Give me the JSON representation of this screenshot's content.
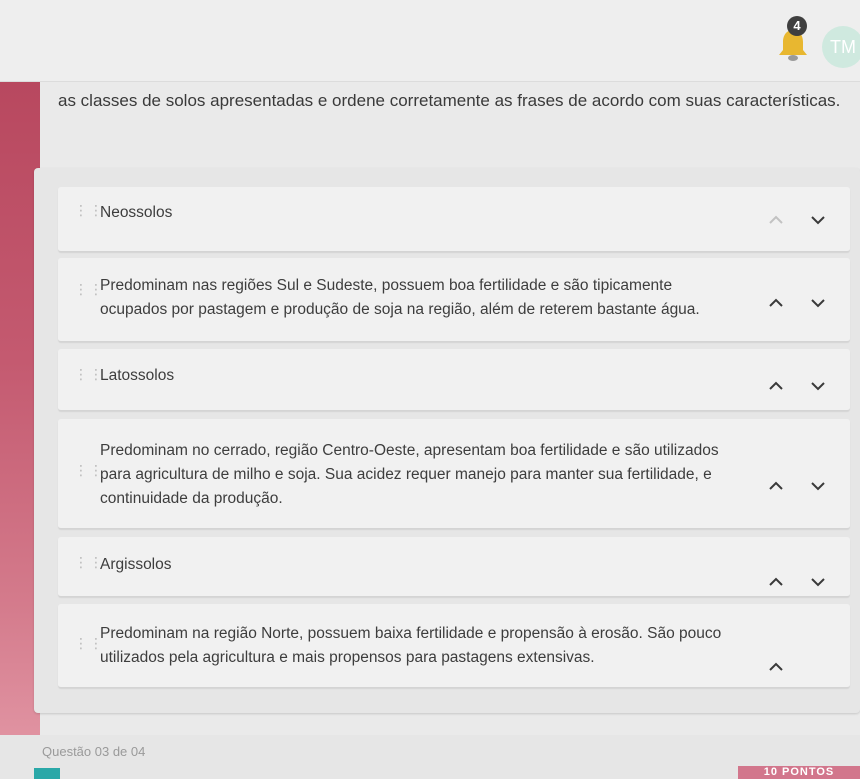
{
  "header": {
    "notification_count": "4",
    "avatar_initials": "TM",
    "colors": {
      "badge": "#3f3f3f",
      "avatar": "#cfe9df"
    }
  },
  "question": {
    "intro": "as classes de solos apresentadas e ordene corretamente as frases de acordo com suas características."
  },
  "items": [
    {
      "text": "Neossolos",
      "up": false,
      "down": true
    },
    {
      "text": "Predominam nas regiões Sul e Sudeste, possuem boa fertilidade e são tipicamente ocupados por pastagem e produção de soja na região, além de reterem bastante água.",
      "up": true,
      "down": true
    },
    {
      "text": "Latossolos",
      "up": true,
      "down": true
    },
    {
      "text": "Predominam no cerrado, região Centro-Oeste, apresentam boa fertilidade e são utilizados para agricultura de milho e soja. Sua acidez requer manejo para manter sua fertilidade, e continuidade da produção.",
      "up": true,
      "down": true
    },
    {
      "text": "Argissolos",
      "up": true,
      "down": true
    },
    {
      "text": "Predominam na região Norte, possuem baixa fertilidade e propensão à erosão. São pouco utilizados pela agricultura e mais propensos para pastagens extensivas.",
      "up": true,
      "down": false
    }
  ],
  "footer": {
    "question_counter": "Questão 03 de 04",
    "points": "10 PONTOS",
    "accent": "#d2768c"
  }
}
